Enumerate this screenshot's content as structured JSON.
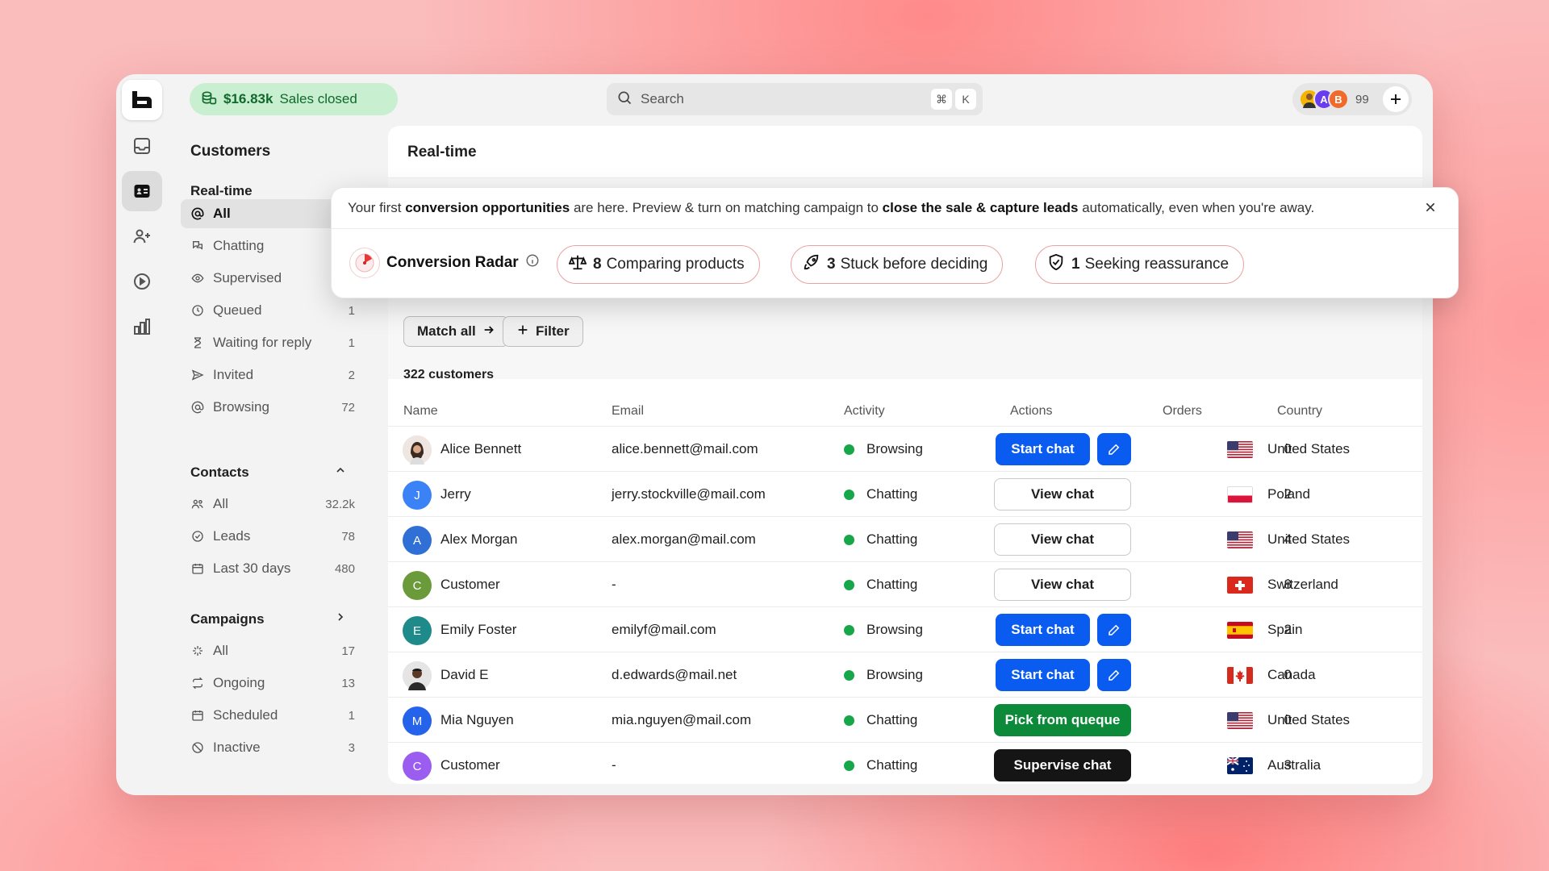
{
  "topbar": {
    "sales_amount": "$16.83k",
    "sales_label": "Sales closed",
    "search_placeholder": "Search",
    "kbd_cmd": "⌘",
    "kbd_k": "K",
    "avatar_initials": [
      "A",
      "B"
    ],
    "online_count": "99"
  },
  "sidebar": {
    "title": "Customers",
    "realtime_header": "Real-time",
    "realtime_items": [
      {
        "label": "All",
        "count": ""
      },
      {
        "label": "Chatting",
        "count": ""
      },
      {
        "label": "Supervised",
        "count": ""
      },
      {
        "label": "Queued",
        "count": "1"
      },
      {
        "label": "Waiting for reply",
        "count": "1"
      },
      {
        "label": "Invited",
        "count": "2"
      },
      {
        "label": "Browsing",
        "count": "72"
      }
    ],
    "contacts_header": "Contacts",
    "contacts_items": [
      {
        "label": "All",
        "count": "32.2k"
      },
      {
        "label": "Leads",
        "count": "78"
      },
      {
        "label": "Last 30 days",
        "count": "480"
      }
    ],
    "campaigns_header": "Campaigns",
    "campaigns_items": [
      {
        "label": "All",
        "count": "17"
      },
      {
        "label": "Ongoing",
        "count": "13"
      },
      {
        "label": "Scheduled",
        "count": "1"
      },
      {
        "label": "Inactive",
        "count": "3"
      }
    ]
  },
  "main": {
    "title": "Real-time",
    "match_all": "Match all",
    "filter": "Filter",
    "count_label": "322 customers",
    "columns": [
      "Name",
      "Email",
      "Activity",
      "Actions",
      "Orders",
      "Country"
    ],
    "rows": [
      {
        "name": "Alice Bennett",
        "initial": "",
        "email": "alice.bennett@mail.com",
        "activity": "Browsing",
        "action": "Start chat",
        "orders": "0",
        "country": "United States"
      },
      {
        "name": "Jerry",
        "initial": "J",
        "email": "jerry.stockville@mail.com",
        "activity": "Chatting",
        "action": "View chat",
        "orders": "2",
        "country": "Poland"
      },
      {
        "name": "Alex Morgan",
        "initial": "A",
        "email": "alex.morgan@mail.com",
        "activity": "Chatting",
        "action": "View chat",
        "orders": "4",
        "country": "United States"
      },
      {
        "name": "Customer",
        "initial": "C",
        "email": "-",
        "activity": "Chatting",
        "action": "View chat",
        "orders": "8",
        "country": "Switzerland"
      },
      {
        "name": "Emily Foster",
        "initial": "E",
        "email": "emilyf@mail.com",
        "activity": "Browsing",
        "action": "Start chat",
        "orders": "2",
        "country": "Spain"
      },
      {
        "name": "David E",
        "initial": "",
        "email": "d.edwards@mail.net",
        "activity": "Browsing",
        "action": "Start chat",
        "orders": "0",
        "country": "Canada"
      },
      {
        "name": "Mia Nguyen",
        "initial": "M",
        "email": "mia.nguyen@mail.com",
        "activity": "Chatting",
        "action": "Pick from queque",
        "orders": "0",
        "country": "United States"
      },
      {
        "name": "Customer",
        "initial": "C",
        "email": "-",
        "activity": "Chatting",
        "action": "Supervise chat",
        "orders": "3",
        "country": "Australia"
      }
    ]
  },
  "popup": {
    "msg_1": "Your first ",
    "msg_b1": "conversion opportunities",
    "msg_2": " are here. Preview & turn on matching campaign to ",
    "msg_b2": "close the sale & capture leads",
    "msg_3": " automatically, even when you're away.",
    "radar_label": "Conversion Radar",
    "pills": [
      {
        "count": "8",
        "label": "Comparing products"
      },
      {
        "count": "3",
        "label": "Stuck before deciding"
      },
      {
        "count": "1",
        "label": "Seeking reassurance"
      }
    ]
  },
  "colors": {
    "primary": "#0a5cf0",
    "success": "#0c8a3a",
    "sales_bg": "#c8efcf"
  }
}
